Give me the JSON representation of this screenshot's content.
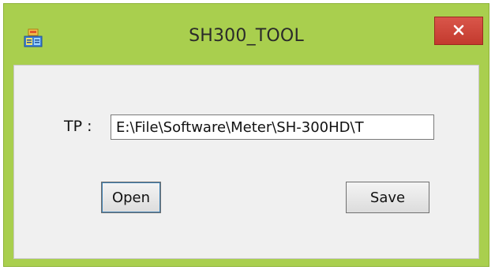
{
  "window": {
    "title": "SH300_TOOL",
    "frame_color": "#a9cf4e",
    "close_color": "#c7453a"
  },
  "app_icon": {
    "icon": "application-icon"
  },
  "close_button": {
    "icon": "close-icon"
  },
  "form": {
    "tp_label": "TP :",
    "tp_value": "E:\\File\\Software\\Meter\\SH-300HD\\T"
  },
  "buttons": {
    "open_label": "Open",
    "save_label": "Save"
  }
}
